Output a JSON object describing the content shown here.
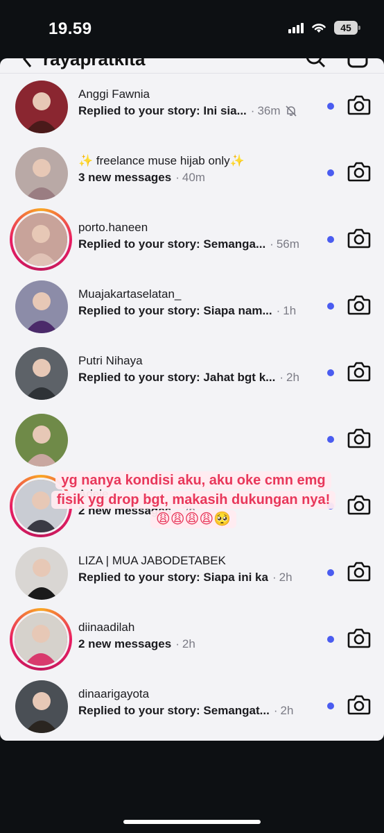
{
  "status": {
    "time": "19.59",
    "battery": "45"
  },
  "header": {
    "title": "rayapratkita"
  },
  "threads": [
    {
      "name": "Anggi Fawnia",
      "message": "Replied to your story: Ini sia...",
      "time": "36m",
      "muted": true,
      "ring": false,
      "avatar_bg": "#8a2630",
      "avatar_fg": "#4a1a1a"
    },
    {
      "name": "✨ freelance muse hijab only✨",
      "message": "3 new messages",
      "time": "40m",
      "muted": false,
      "ring": false,
      "avatar_bg": "#b9a9a6",
      "avatar_fg": "#9a7d82"
    },
    {
      "name": "porto.haneen",
      "message": "Replied to your story: Semanga...",
      "time": "56m",
      "muted": false,
      "ring": true,
      "avatar_bg": "#c8a39a",
      "avatar_fg": "#e0c2b6"
    },
    {
      "name": "Muajakartaselatan_",
      "message": "Replied to your story: Siapa nam...",
      "time": "1h",
      "muted": false,
      "ring": false,
      "avatar_bg": "#8c8ca8",
      "avatar_fg": "#4b2a6a"
    },
    {
      "name": "Putri Nihaya",
      "message": "Replied to your story: Jahat bgt k...",
      "time": "2h",
      "muted": false,
      "ring": false,
      "avatar_bg": "#5d6268",
      "avatar_fg": "#2e3236"
    },
    {
      "name": "",
      "message": "",
      "time": "",
      "muted": false,
      "ring": false,
      "avatar_bg": "#6f8a48",
      "avatar_fg": "#c9a7a0"
    },
    {
      "name": "Adele",
      "message": "2 new messages",
      "time": "2h",
      "muted": false,
      "ring": true,
      "avatar_bg": "#c9ccd3",
      "avatar_fg": "#3a3a44"
    },
    {
      "name": "LIZA | MUA JABODETABEK",
      "message": "Replied to your story: Siapa ini ka",
      "time": "2h",
      "muted": false,
      "ring": false,
      "avatar_bg": "#d9d6d3",
      "avatar_fg": "#1a1a1a"
    },
    {
      "name": "diinaadilah",
      "message": "2 new messages",
      "time": "2h",
      "muted": false,
      "ring": true,
      "avatar_bg": "#d6d2cc",
      "avatar_fg": "#d83a6d"
    },
    {
      "name": "dinaarigayota",
      "message": "Replied to your story: Semangat...",
      "time": "2h",
      "muted": false,
      "ring": false,
      "avatar_bg": "#4a4f55",
      "avatar_fg": "#2a2520"
    }
  ],
  "overlay_caption": "yg nanya kondisi aku, aku oke cmn emg fisik yg drop bgt, makasih dukungan nya!😩😩😩😩🥺",
  "colors": {
    "unread_dot": "#4a5cf0",
    "caption": "#e8375a",
    "sheet_bg": "#f3f3f6"
  }
}
